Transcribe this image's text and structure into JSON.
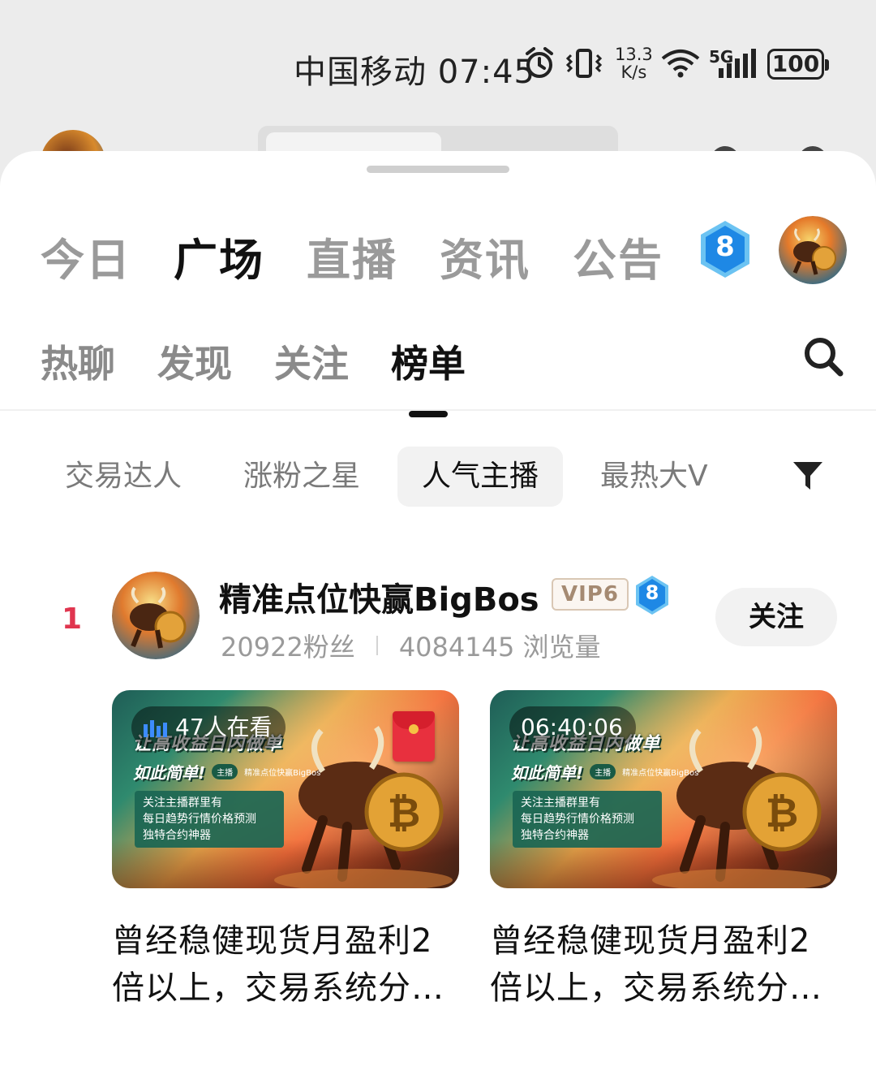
{
  "status_bar": {
    "carrier_time": "中国移动 07:45",
    "net_speed_value": "13.3",
    "net_speed_unit": "K/s",
    "network_label": "5G",
    "battery": "100"
  },
  "top_tabs": [
    {
      "label": "今日",
      "active": false
    },
    {
      "label": "广场",
      "active": true
    },
    {
      "label": "直播",
      "active": false
    },
    {
      "label": "资讯",
      "active": false
    },
    {
      "label": "公告",
      "active": false
    }
  ],
  "user": {
    "level": "8"
  },
  "sub_tabs": [
    {
      "label": "热聊",
      "active": false
    },
    {
      "label": "发现",
      "active": false
    },
    {
      "label": "关注",
      "active": false
    },
    {
      "label": "榜单",
      "active": true
    }
  ],
  "chips": [
    {
      "label": "交易达人",
      "active": false
    },
    {
      "label": "涨粉之星",
      "active": false
    },
    {
      "label": "人气主播",
      "active": true
    },
    {
      "label": "最热大V",
      "active": false
    }
  ],
  "ranking": [
    {
      "rank": "1",
      "name": "精准点位快赢BigBos",
      "vip": "VIP6",
      "level": "8",
      "fans": "20922粉丝",
      "views": "4084145 浏览量",
      "follow_label": "关注",
      "streams": [
        {
          "overlay": "47人在看",
          "is_live": true,
          "thumb_line1": "让高收益日内做单",
          "thumb_line2": "如此简单!",
          "host_tag": "主播",
          "host_name": "精准点位快赢BigBos",
          "thumb_box": [
            "关注主播群里有",
            "每日趋势行情价格预测",
            "独特合约神器"
          ],
          "title": "曾经稳健现货月盈利2倍以上，交易系统分…"
        },
        {
          "overlay": "06:40:06",
          "is_live": false,
          "thumb_line1": "让高收益日内做单",
          "thumb_line2": "如此简单!",
          "host_tag": "主播",
          "host_name": "精准点位快赢BigBos",
          "thumb_box": [
            "关注主播群里有",
            "每日趋势行情价格预测",
            "独特合约神器"
          ],
          "title": "曾经稳健现货月盈利2倍以上，交易系统分…"
        }
      ]
    }
  ],
  "colors": {
    "rank_red": "#e0354f",
    "badge_blue": "#1e88e5",
    "chip_active_bg": "#f2f2f2",
    "thumb_teal": "#1a6654"
  },
  "icons": [
    "alarm-icon",
    "vibrate-icon",
    "wifi-icon",
    "signal-icon",
    "search-icon",
    "filter-icon",
    "live-bars-icon",
    "red-packet-icon"
  ]
}
